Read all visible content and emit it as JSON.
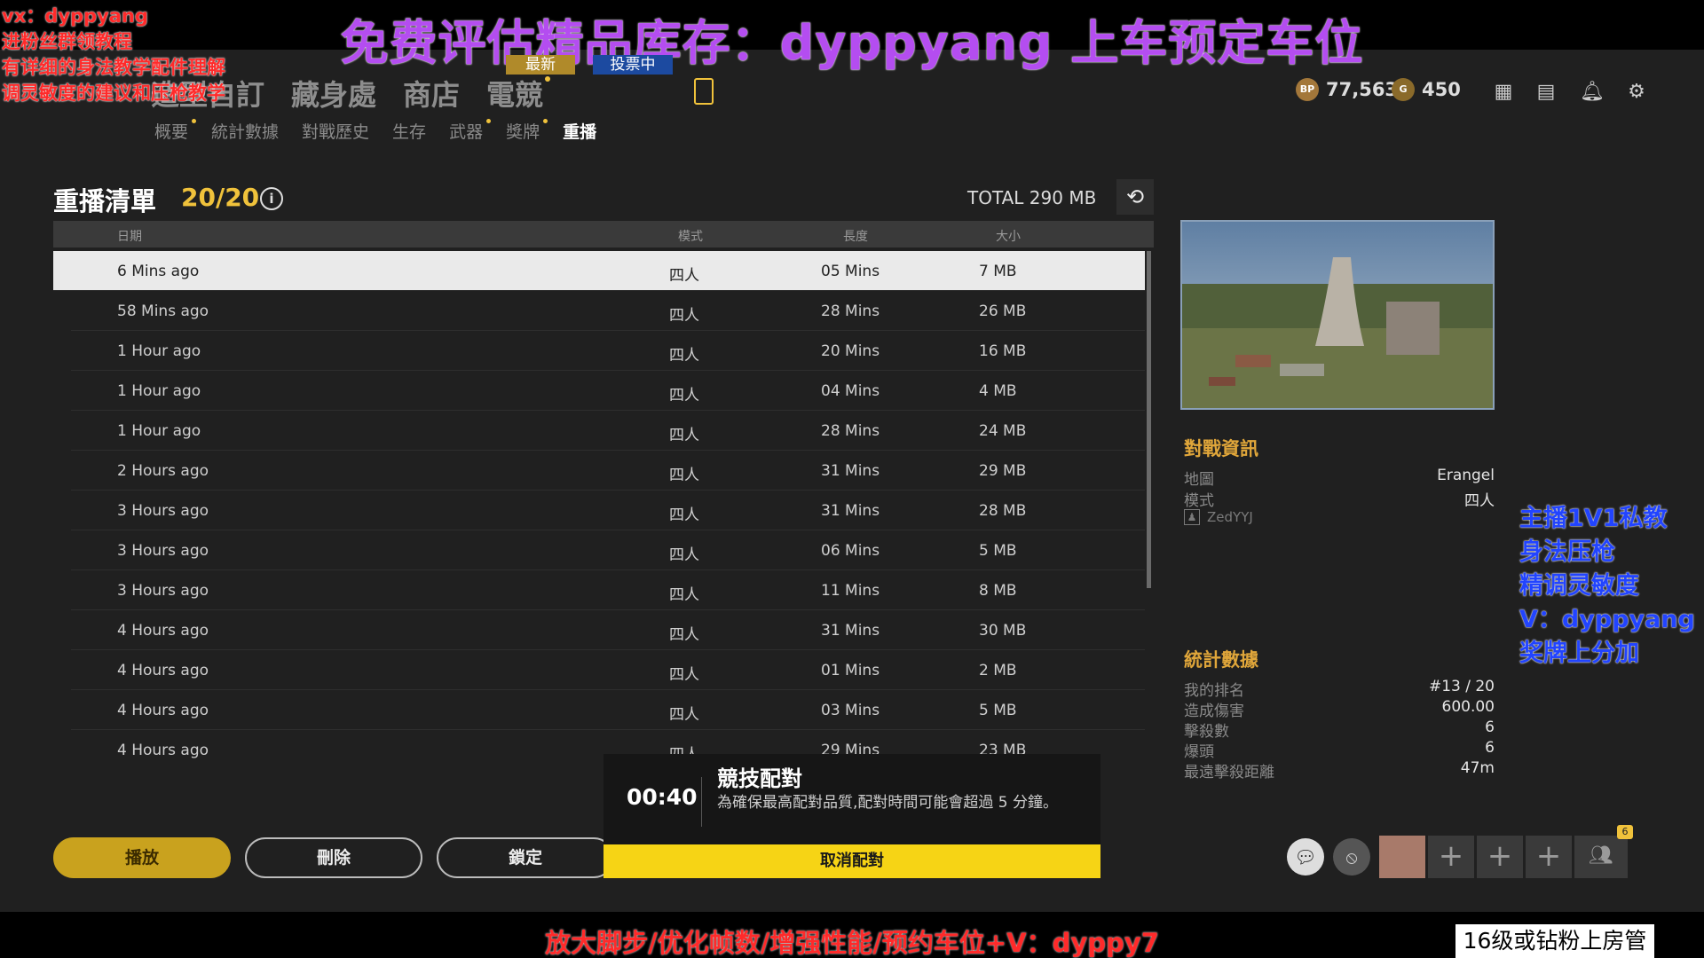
{
  "overlay": {
    "banner": "免费评估精品库存：dyppyang   上车预定车位",
    "left_lines": [
      "vx：dyppyang",
      "进粉丝群领教程",
      "有详细的身法教学配件理解",
      "调灵敏度的建议和压枪教学"
    ],
    "right_lines": [
      "主播1V1私教",
      "身法压枪",
      "精调灵敏度",
      "V：dyppyang",
      "奖牌上分加"
    ],
    "bottom_text": "放大脚步/优化帧数/增强性能/预约车位+V：dyppy7",
    "bottom_badge": "16级或钻粉上房管"
  },
  "header": {
    "main_nav": [
      "造型自訂",
      "藏身處",
      "商店",
      "電競"
    ],
    "tag_new": "最新",
    "tag_vote": "投票中",
    "sub_nav": [
      "概要",
      "統計數據",
      "對戰歷史",
      "生存",
      "武器",
      "獎牌",
      "重播"
    ],
    "bp_icon": "BP",
    "bp_amount": "77,563",
    "g_icon": "G",
    "g_amount": "450",
    "colors": {
      "accent": "#f0c23b",
      "selected_row": "#eaeaea",
      "cancel": "#f6d415"
    }
  },
  "replay": {
    "title": "重播清單",
    "count": "20/20",
    "total": "TOTAL 290 MB",
    "columns": [
      "日期",
      "模式",
      "長度",
      "大小"
    ],
    "rows": [
      {
        "date": "6 Mins ago",
        "mode": "四人",
        "length": "05 Mins",
        "size": "7 MB"
      },
      {
        "date": "58 Mins ago",
        "mode": "四人",
        "length": "28 Mins",
        "size": "26 MB"
      },
      {
        "date": "1 Hour ago",
        "mode": "四人",
        "length": "20 Mins",
        "size": "16 MB"
      },
      {
        "date": "1 Hour ago",
        "mode": "四人",
        "length": "04 Mins",
        "size": "4 MB"
      },
      {
        "date": "1 Hour ago",
        "mode": "四人",
        "length": "28 Mins",
        "size": "24 MB"
      },
      {
        "date": "2 Hours ago",
        "mode": "四人",
        "length": "31 Mins",
        "size": "29 MB"
      },
      {
        "date": "3 Hours ago",
        "mode": "四人",
        "length": "31 Mins",
        "size": "28 MB"
      },
      {
        "date": "3 Hours ago",
        "mode": "四人",
        "length": "06 Mins",
        "size": "5 MB"
      },
      {
        "date": "3 Hours ago",
        "mode": "四人",
        "length": "11 Mins",
        "size": "8 MB"
      },
      {
        "date": "4 Hours ago",
        "mode": "四人",
        "length": "31 Mins",
        "size": "30 MB"
      },
      {
        "date": "4 Hours ago",
        "mode": "四人",
        "length": "01 Mins",
        "size": "2 MB"
      },
      {
        "date": "4 Hours ago",
        "mode": "四人",
        "length": "03 Mins",
        "size": "5 MB"
      },
      {
        "date": "4 Hours ago",
        "mode": "四人",
        "length": "29 Mins",
        "size": "23 MB"
      }
    ]
  },
  "match_info": {
    "title": "對戰資訊",
    "map_label": "地圖",
    "map_value": "Erangel",
    "mode_label": "模式",
    "mode_value": "四人",
    "player": "ZedYYJ"
  },
  "stats": {
    "title": "統計數據",
    "items": [
      {
        "label": "我的排名",
        "value": "#13 / 20"
      },
      {
        "label": "造成傷害",
        "value": "600.00"
      },
      {
        "label": "擊殺數",
        "value": "6"
      },
      {
        "label": "爆頭",
        "value": "6"
      },
      {
        "label": "最遠擊殺距離",
        "value": "47m"
      }
    ]
  },
  "actions": {
    "play": "播放",
    "delete": "刪除",
    "lock": "鎖定"
  },
  "matchmaking": {
    "timer": "00:40",
    "title": "競技配對",
    "desc": "為確保最高配對品質,配對時間可能會超過 5 分鐘。",
    "cancel": "取消配對"
  },
  "squad": {
    "count_badge": "6"
  }
}
